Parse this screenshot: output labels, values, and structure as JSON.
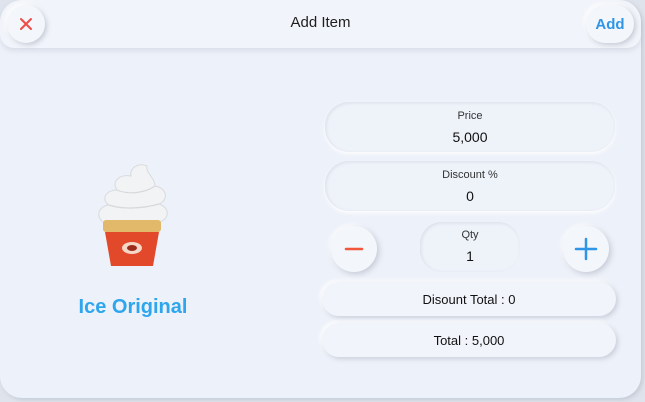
{
  "header": {
    "title": "Add Item",
    "add_label": "Add",
    "close_icon": "close-icon"
  },
  "product": {
    "name": "Ice Original",
    "image": "ice-cream-cone"
  },
  "form": {
    "price_label": "Price",
    "price_value": "5,000",
    "discount_label": "Discount %",
    "discount_value": "0",
    "qty_label": "Qty",
    "qty_value": "1",
    "discount_total": "Disount Total : 0",
    "total": "Total : 5,000"
  },
  "colors": {
    "accent": "#2f95e6",
    "minus": "#f0573b",
    "close": "#ef4b45",
    "product_name": "#2ea6ee"
  }
}
